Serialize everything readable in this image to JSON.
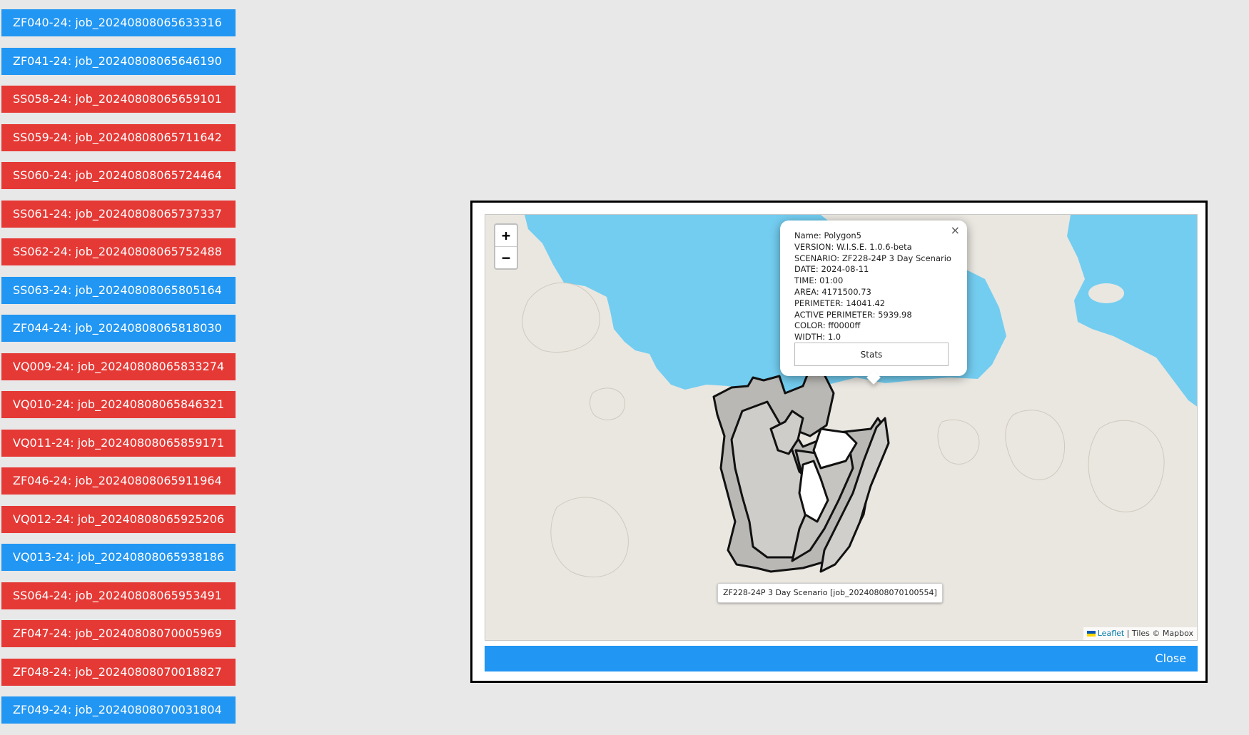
{
  "jobs": [
    {
      "label": "ZF040-24: job_20240808065633316",
      "color": "blue"
    },
    {
      "label": "ZF041-24: job_20240808065646190",
      "color": "blue"
    },
    {
      "label": "SS058-24: job_20240808065659101",
      "color": "red"
    },
    {
      "label": "SS059-24: job_20240808065711642",
      "color": "red"
    },
    {
      "label": "SS060-24: job_20240808065724464",
      "color": "red"
    },
    {
      "label": "SS061-24: job_20240808065737337",
      "color": "red"
    },
    {
      "label": "SS062-24: job_20240808065752488",
      "color": "red"
    },
    {
      "label": "SS063-24: job_20240808065805164",
      "color": "blue"
    },
    {
      "label": "ZF044-24: job_20240808065818030",
      "color": "blue"
    },
    {
      "label": "VQ009-24: job_20240808065833274",
      "color": "red"
    },
    {
      "label": "VQ010-24: job_20240808065846321",
      "color": "red"
    },
    {
      "label": "VQ011-24: job_20240808065859171",
      "color": "red"
    },
    {
      "label": "ZF046-24: job_20240808065911964",
      "color": "red"
    },
    {
      "label": "VQ012-24: job_20240808065925206",
      "color": "red"
    },
    {
      "label": "VQ013-24: job_20240808065938186",
      "color": "blue"
    },
    {
      "label": "SS064-24: job_20240808065953491",
      "color": "red"
    },
    {
      "label": "ZF047-24: job_20240808070005969",
      "color": "red"
    },
    {
      "label": "ZF048-24: job_20240808070018827",
      "color": "red"
    },
    {
      "label": "ZF049-24: job_20240808070031804",
      "color": "blue"
    }
  ],
  "colors": {
    "blue": "#2196f3",
    "red": "#e53935",
    "water": "#73cdf0",
    "land": "#eae7e1"
  },
  "map": {
    "zoom_in": "+",
    "zoom_out": "−",
    "popup": {
      "close": "×",
      "lines": [
        "Name: Polygon5",
        "VERSION: W.I.S.E. 1.0.6-beta",
        "SCENARIO: ZF228-24P 3 Day Scenario",
        "DATE: 2024-08-11",
        "TIME: 01:00",
        "AREA: 4171500.73",
        "PERIMETER: 14041.42",
        "ACTIVE PERIMETER: 5939.98",
        "COLOR: ff0000ff",
        "WIDTH: 1.0"
      ],
      "stats_button": "Stats"
    },
    "tooltip": "ZF228-24P 3 Day Scenario [job_20240808070100554]",
    "attribution": {
      "leaflet": "Leaflet",
      "tiles": " | Tiles © Mapbox"
    }
  },
  "modal": {
    "close_label": "Close"
  }
}
